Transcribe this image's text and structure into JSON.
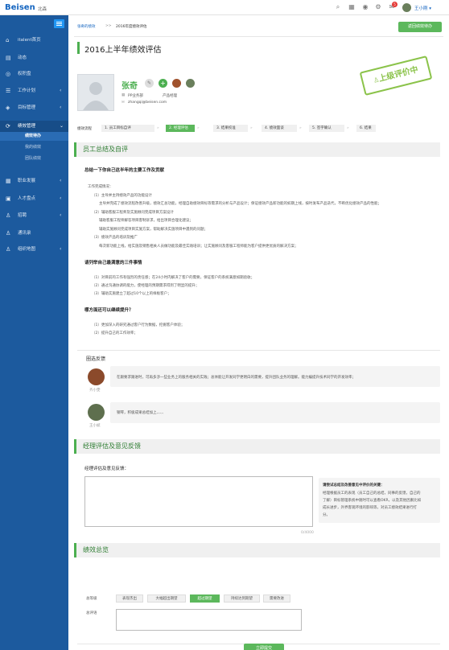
{
  "topbar": {
    "logo": "Beisen",
    "city": "北森",
    "username": "王小刚",
    "notif_count": "5"
  },
  "sidebar": {
    "items": [
      {
        "label": "italent首页",
        "icon": "home-icon",
        "glyph": "⌂",
        "chev": ""
      },
      {
        "label": "动态",
        "icon": "feed-icon",
        "glyph": "▤",
        "chev": ""
      },
      {
        "label": "权积盘",
        "icon": "target-icon",
        "glyph": "◎",
        "chev": ""
      },
      {
        "label": "工作计划",
        "icon": "list-icon",
        "glyph": "☰",
        "chev": "‹"
      },
      {
        "label": "目标管理",
        "icon": "goal-icon",
        "glyph": "◈",
        "chev": "‹"
      },
      {
        "label": "绩效管理",
        "icon": "chart-icon",
        "glyph": "⟳",
        "chev": "⌄"
      },
      {
        "label": "职业发展",
        "icon": "career-icon",
        "glyph": "▦",
        "chev": "‹"
      },
      {
        "label": "人才盘点",
        "icon": "talent-icon",
        "glyph": "▣",
        "chev": "‹"
      },
      {
        "label": "招聘",
        "icon": "recruit-icon",
        "glyph": "♙",
        "chev": "‹"
      },
      {
        "label": "通讯录",
        "icon": "contacts-icon",
        "glyph": "♙",
        "chev": ""
      },
      {
        "label": "组织地图",
        "icon": "org-icon",
        "glyph": "♙",
        "chev": "‹"
      }
    ],
    "sub_items": [
      "绩效待办",
      "我的绩效",
      "团队绩效"
    ]
  },
  "breadcrumb": {
    "link": "张奇的绩效",
    "sep": ">>",
    "current": "2016年度绩效评估"
  },
  "back_button": "返回绩效待办",
  "page_title": "2016上半年绩效评估",
  "profile": {
    "name": "张奇",
    "dept": "PP业务部",
    "role": "产品经理",
    "email": "zhangqi@beisen.com"
  },
  "stamp": "上级评价中",
  "flow": {
    "label": "绩效流程",
    "steps": [
      "1. 员工目标自评",
      "2. 经理评估",
      "3. 结果校准",
      "4. 绩效面谈",
      "5. 签字确认",
      "6. 结果"
    ],
    "current_index": 1
  },
  "self_eval": {
    "title": "员工总结及自评",
    "q1": "总结一下你自己这半年的主要工作及贡献",
    "a1": [
      "工作完成情况：",
      "（1）主导并主持绩效产品的功能设计",
      "主导并完成了绩效流程改善升级，绩效汇总功能，经理自助绩效目标等需求的分析与产品设计；保证绩效产品新功能的如期上线，按时发布产品迭代，不断优化绩效产品的性能；",
      "（2）辅助客服工程师及实施顾问完成项目方案设计",
      "辅助客服工程师解答项目客制诉求，给出项目合理化建议；",
      "辅助实施顾问完成项目实施方案，帮助解决实施项目中遇到的问题；",
      "（3）绩效产品的培训及推广",
      "每次新功能上线，给实施及销售相关人员做功能及最佳实践培训；让实施顾问及客服工程师能为客户提供更优质的解决方案；"
    ],
    "q2": "请列举自己最满意的三件事情",
    "a2": [
      "（1）对目前的工作有强烈的责任感；在24小时内解决了客户的需要，保证客户的系统满意如期验收；",
      "（2）通过沟通协调的能力，使经理的预期需求得到了明显的提升；",
      "（3）辅助实施建立了超过10个以上的样板客户；"
    ],
    "q3": "哪方面还可以继续提升？",
    "a3": [
      "（1）更加深入的研究通过客户行为数据，挖掘客户体验；",
      "（2）提升自己的工作效率；"
    ]
  },
  "feedback": {
    "title": "圈选反馈",
    "items": [
      {
        "author": "齐小雯",
        "text": "在跟要求跟进时，可再多涉一些业务上的服务相关的实践；总体能让开发同学更明白的需要，提升团队业务的理解。能力编提升技术同学的开发效率；"
      },
      {
        "author": "王小斌",
        "text": "钢琴，积极成果总结加上、、、、"
      }
    ]
  },
  "manager": {
    "title": "经理评估及意见反馈",
    "field_label": "经理评估及意见反馈：",
    "counter": "0/4000",
    "guide_title": "请尝试总结及改善意见中评价的关键：",
    "guide_text": [
      "经理根据员工的表现（员工自己的总结，同事的反馈，自己的",
      "了解）目标管理系统中随时可以查看OKR，以及其他因素比如",
      "成长进步，外界客观环境的影响等，对员工绩效结果进行打",
      "分。"
    ]
  },
  "overview": {
    "title": "绩效总览",
    "grade_label": "总等级",
    "grades": [
      "表现杰出",
      "大幅超出期望",
      "超过期望",
      "持续达到期望",
      "需要改进"
    ],
    "selected_grade": 2,
    "comment_label": "总评语"
  },
  "submit": "立即提交"
}
